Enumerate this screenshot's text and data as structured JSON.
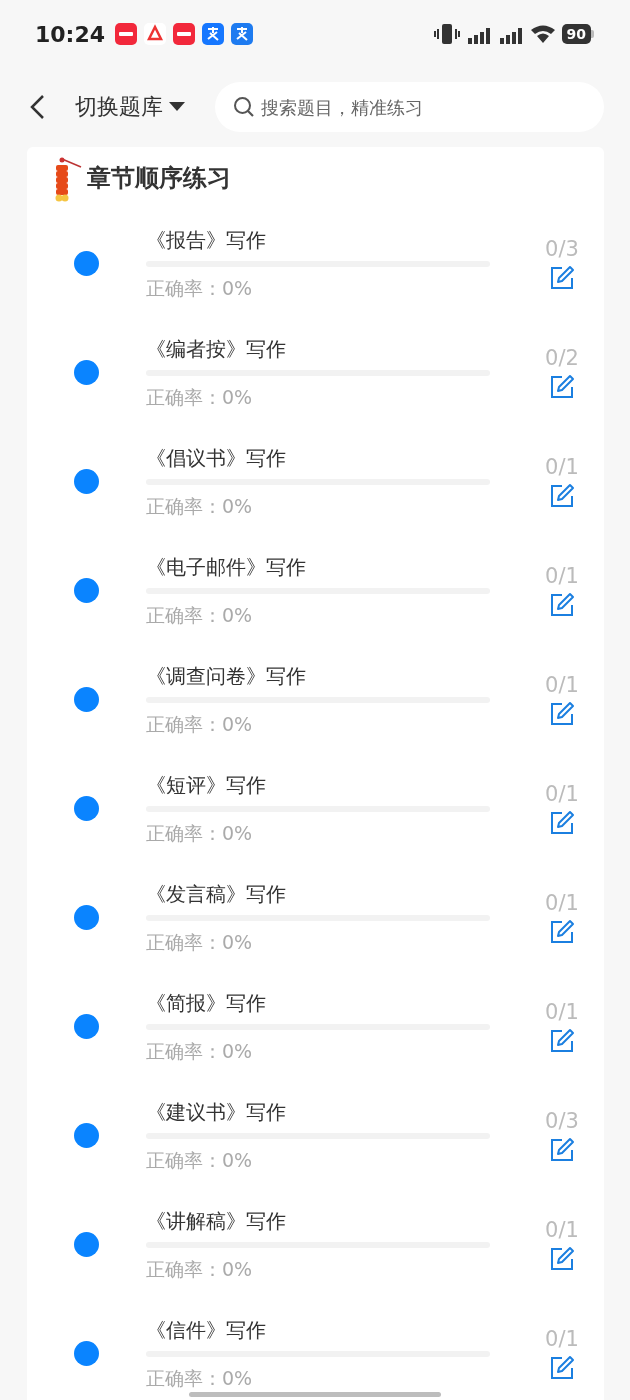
{
  "status_bar": {
    "time": "10:24",
    "battery": "90"
  },
  "header": {
    "title": "切换题库",
    "search": {
      "placeholder": "搜索题目，精准练习"
    }
  },
  "section": {
    "title": "章节顺序练习"
  },
  "chapters": [
    {
      "title": "《报告》写作",
      "level": 0,
      "accuracy": "正确率：0%",
      "count": "0/3"
    },
    {
      "title": "《编者按》写作",
      "level": 0,
      "accuracy": "正确率：0%",
      "count": "0/2"
    },
    {
      "title": "《倡议书》写作",
      "level": 0,
      "accuracy": "正确率：0%",
      "count": "0/1"
    },
    {
      "title": "《电子邮件》写作",
      "level": 0,
      "accuracy": "正确率：0%",
      "count": "0/1"
    },
    {
      "title": "《调查问卷》写作",
      "level": 0,
      "accuracy": "正确率：0%",
      "count": "0/1"
    },
    {
      "title": "《短评》写作",
      "level": 0,
      "accuracy": "正确率：0%",
      "count": "0/1"
    },
    {
      "title": "《发言稿》写作",
      "level": 0,
      "accuracy": "正确率：0%",
      "count": "0/1"
    },
    {
      "title": "《简报》写作",
      "level": 0,
      "accuracy": "正确率：0%",
      "count": "0/1"
    },
    {
      "title": "《建议书》写作",
      "level": 0,
      "accuracy": "正确率：0%",
      "count": "0/3"
    },
    {
      "title": "《讲解稿》写作",
      "level": 0,
      "accuracy": "正确率：0%",
      "count": "0/1"
    },
    {
      "title": "《信件》写作",
      "level": 0,
      "accuracy": "正确率：0%",
      "count": "0/1"
    }
  ]
}
